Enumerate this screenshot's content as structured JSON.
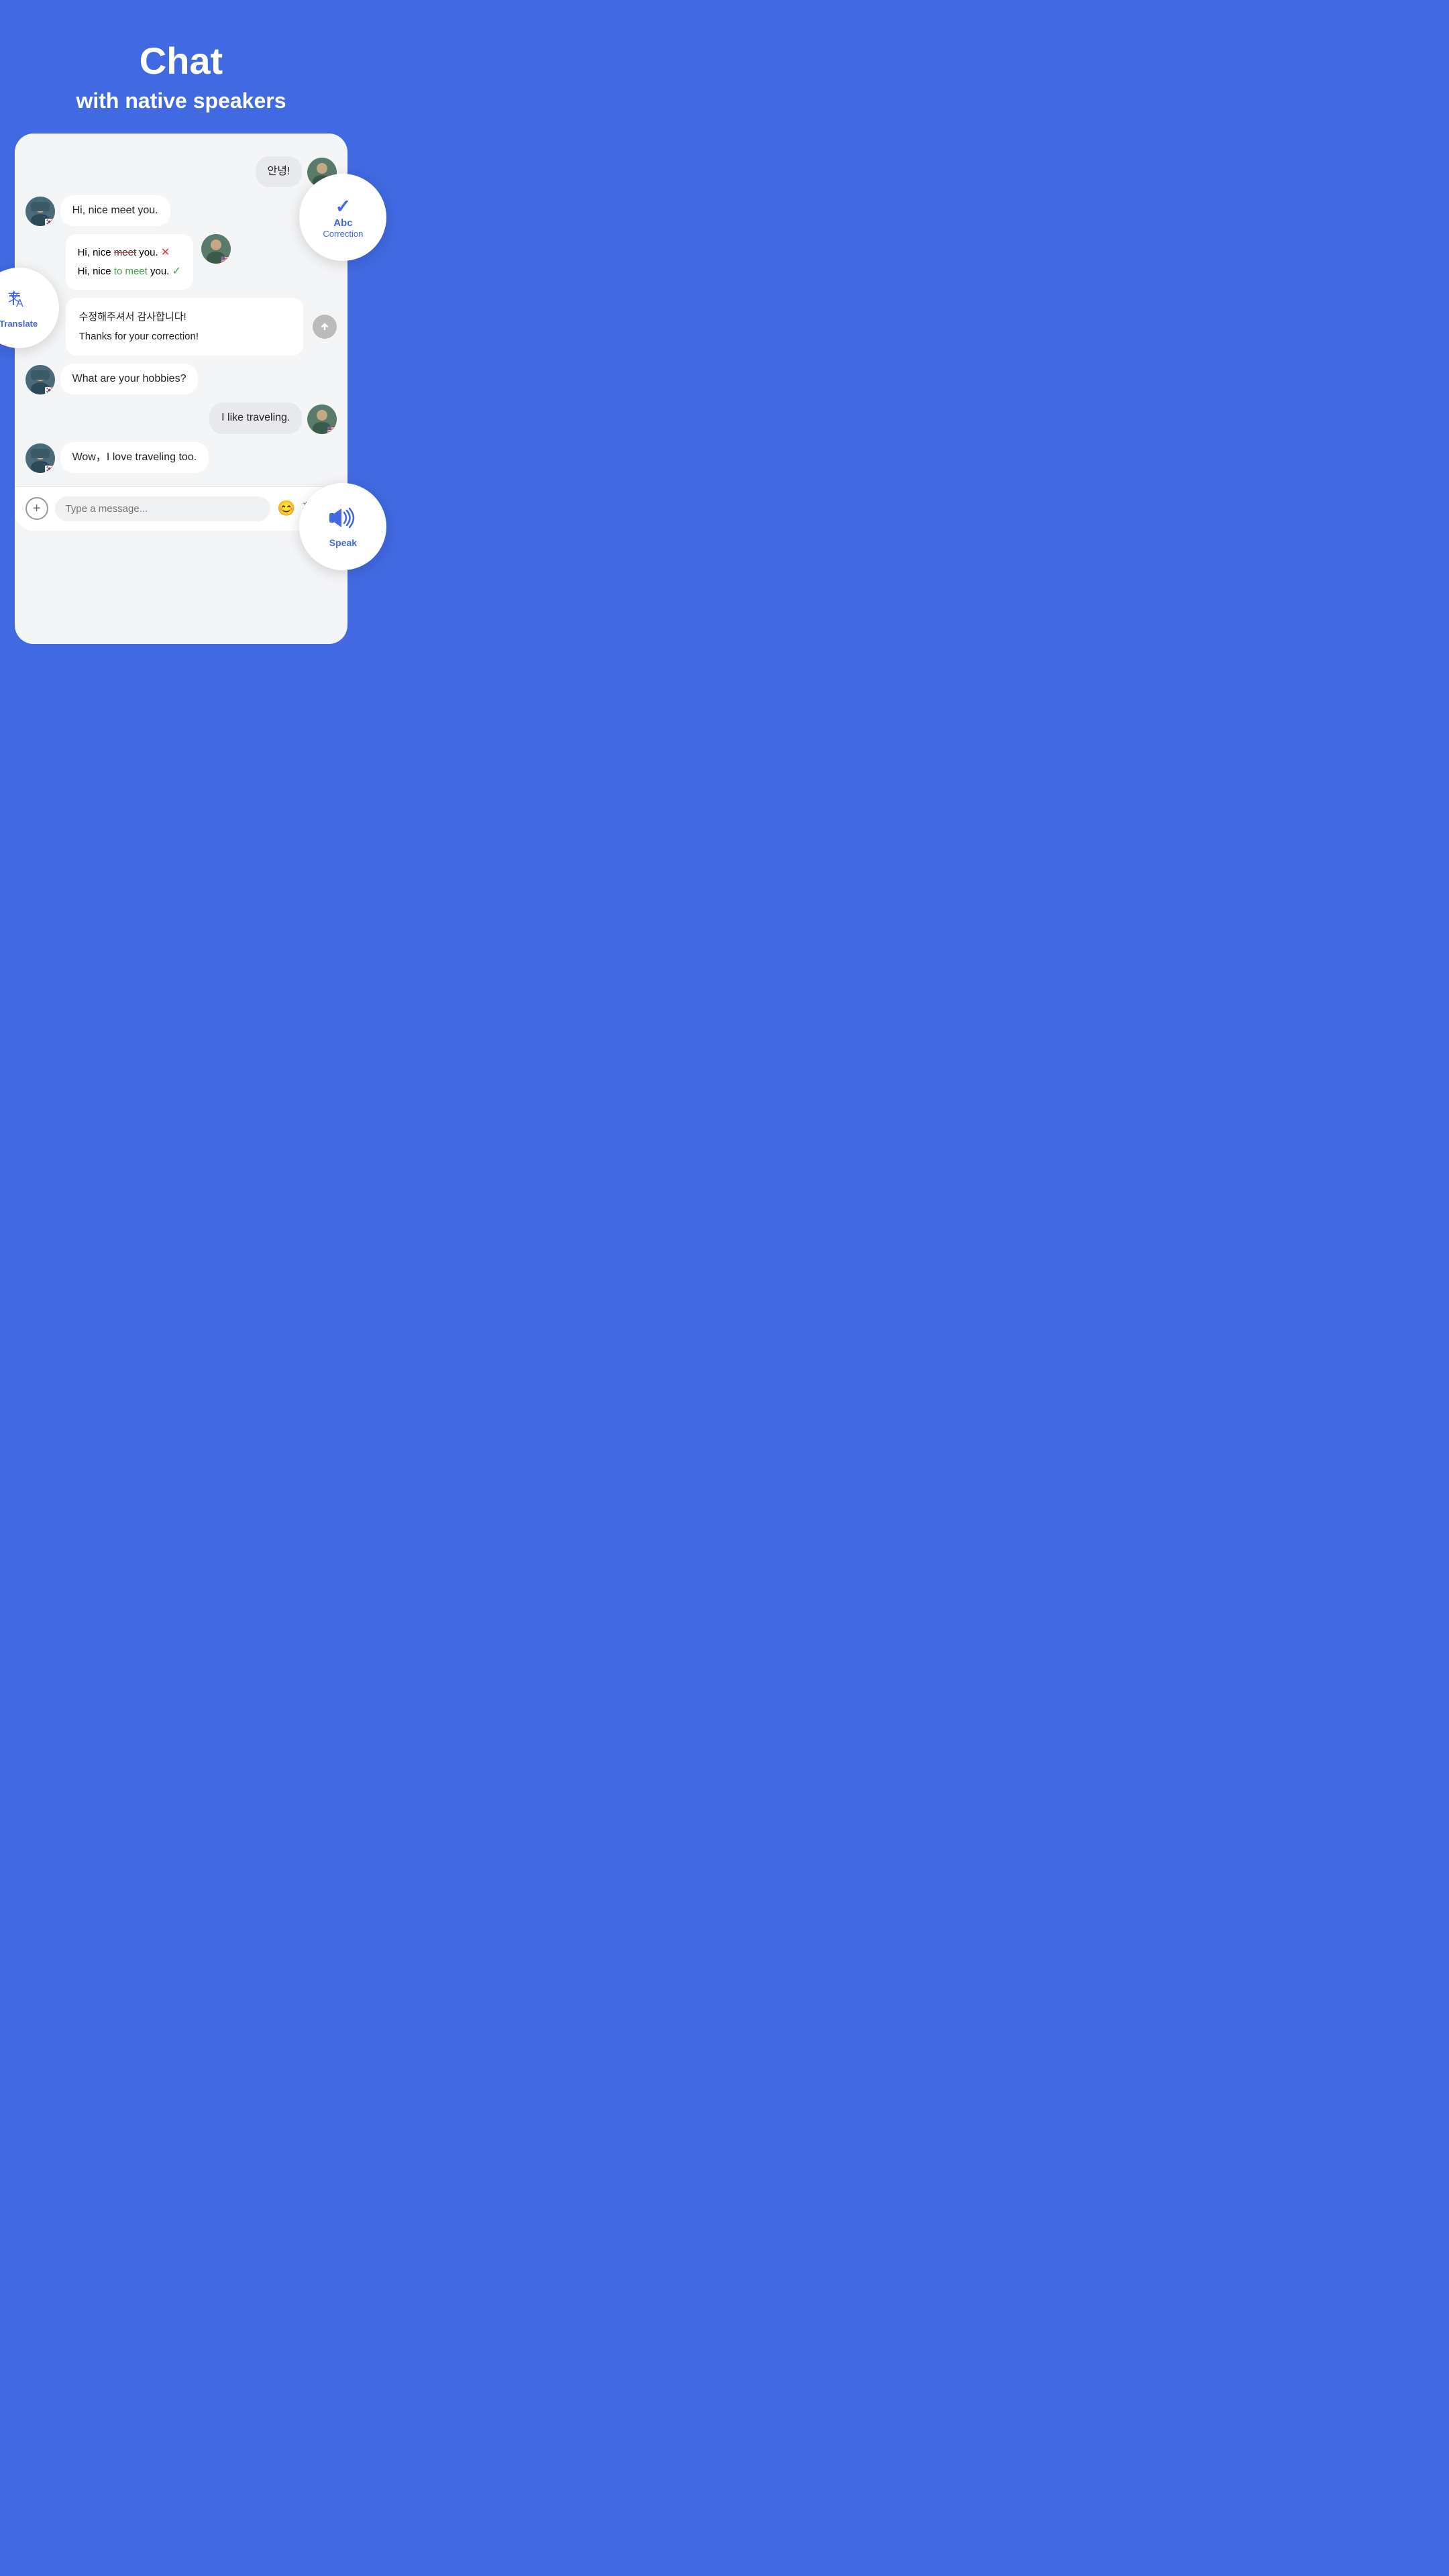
{
  "header": {
    "title": "Chat",
    "subtitle": "with native speakers"
  },
  "messages": [
    {
      "id": "msg1",
      "type": "right",
      "text": "안녕!",
      "avatar": "male-us"
    },
    {
      "id": "msg2",
      "type": "left",
      "text": "Hi, nice meet you.",
      "avatar": "female-kr"
    },
    {
      "id": "correction",
      "type": "correction",
      "wrong_text": "Hi, nice",
      "wrong_word": "meet",
      "wrong_suffix": "you.",
      "correct_text": "Hi, nice",
      "correct_phrase": "to meet",
      "correct_suffix": "you.",
      "avatar": "male-us"
    },
    {
      "id": "msg3",
      "type": "translate-block",
      "korean": "수정해주셔서 감사합니다!",
      "english": "Thanks for your correction!"
    },
    {
      "id": "msg4",
      "type": "left",
      "text": "What are your hobbies?",
      "avatar": "female-kr"
    },
    {
      "id": "msg5",
      "type": "right",
      "text": "I like traveling.",
      "avatar": "male-us"
    },
    {
      "id": "msg6",
      "type": "left",
      "text": "Wow，I love traveling too.",
      "avatar": "female-kr"
    }
  ],
  "input_bar": {
    "placeholder": "Type a message..."
  },
  "features": {
    "abc_correction": {
      "check": "✓",
      "label": "Abc",
      "sublabel": "Correction"
    },
    "translate": {
      "label": "Translate"
    },
    "speak": {
      "label": "Speak"
    }
  }
}
